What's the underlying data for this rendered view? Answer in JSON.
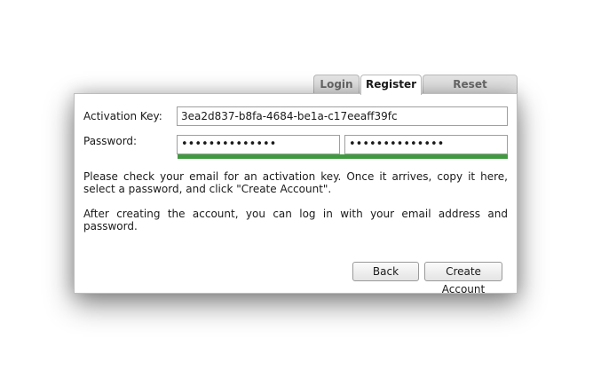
{
  "tabs": [
    {
      "label": "Login"
    },
    {
      "label": "Register",
      "active": true
    },
    {
      "label": "Reset Password"
    }
  ],
  "form": {
    "activation_label": "Activation Key:",
    "activation_value": "3ea2d837-b8fa-4684-be1a-c17eeaff39fc",
    "password_label": "Password:",
    "password_value": "••••••••••••••",
    "password_confirm_value": "••••••••••••••",
    "strength_color": "#3f9a3f"
  },
  "instructions": {
    "line1": "Please check your email for an activation key. Once it arrives, copy it here, select a password, and click \"Create Account\".",
    "line2": "After creating the account, you can log in with your email address and password."
  },
  "buttons": {
    "back": "Back",
    "create": "Create Account"
  }
}
